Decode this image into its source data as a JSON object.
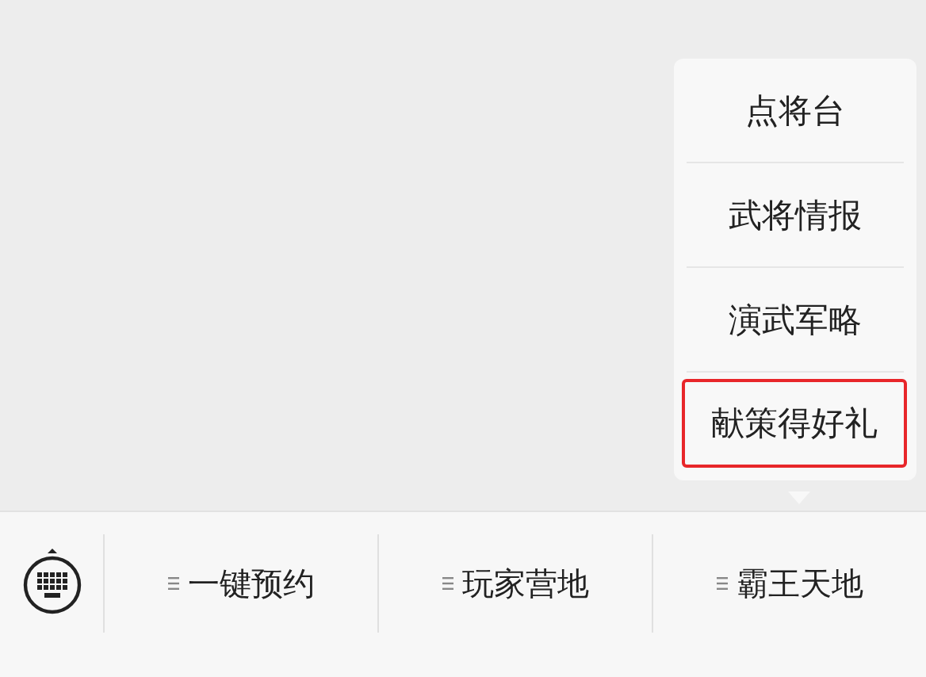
{
  "popup_menu": {
    "items": [
      {
        "label": "点将台",
        "highlighted": false
      },
      {
        "label": "武将情报",
        "highlighted": false
      },
      {
        "label": "演武军略",
        "highlighted": false
      },
      {
        "label": "献策得好礼",
        "highlighted": true
      }
    ]
  },
  "bottom_menu": {
    "items": [
      {
        "label": "一键预约"
      },
      {
        "label": "玩家营地"
      },
      {
        "label": "霸王天地"
      }
    ]
  }
}
